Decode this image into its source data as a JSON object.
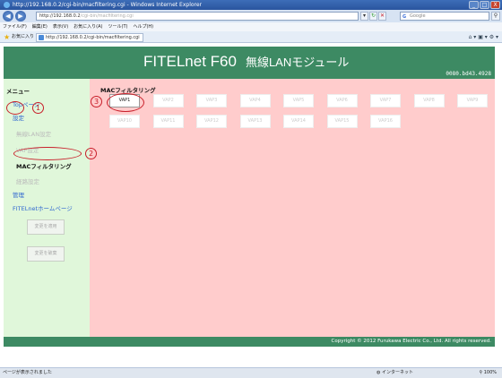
{
  "window": {
    "title": "http://192.168.0.2/cgi-bin/macfiltering.cgi - Windows Internet Explorer",
    "minimize": "_",
    "maximize": "□",
    "close": "X"
  },
  "browser": {
    "back": "◀",
    "forward": "▶",
    "address_host": "http://192.168.0.2",
    "address_path": "/cgi-bin/macfiltering.cgi",
    "search_placeholder": "Google",
    "menu": [
      "ファイル(F)",
      "編集(E)",
      "表示(V)",
      "お気に入り(A)",
      "ツール(T)",
      "ヘルプ(H)"
    ],
    "favorites_label": "お気に入り",
    "tab_title": "http://192.168.0.2/cgi-bin/macfiltering.cgi"
  },
  "banner": {
    "title": "FITELnet F60",
    "subtitle": "無線LANモジュール",
    "mac": "0080.bd43.4928"
  },
  "sidebar": {
    "menu_heading": "メニュー",
    "top_page": "Topページ",
    "settings": "設定",
    "wireless_lan": "無線LAN設定",
    "vap": "VAP設定",
    "mac_filtering": "MACフィルタリング",
    "route": "経路設定",
    "management": "管理",
    "homepage": "FITELnetホームページ",
    "apply_button": "変更を適用",
    "discard_button": "変更を破棄"
  },
  "main": {
    "heading": "MACフィルタリング",
    "vaps": [
      "VAP1",
      "VAP2",
      "VAP3",
      "VAP4",
      "VAP5",
      "VAP6",
      "VAP7",
      "VAP8",
      "VAP9",
      "VAP10",
      "VAP11",
      "VAP12",
      "VAP13",
      "VAP14",
      "VAP15",
      "VAP16"
    ],
    "active_vap": "VAP1"
  },
  "annotations": {
    "n1": "1",
    "n2": "2",
    "n3": "3",
    "color": "#c81f2a"
  },
  "footer": {
    "copyright": "Copyright © 2012 Furukawa Electric Co., Ltd. All rights reserved."
  },
  "statusbar": {
    "text": "ページが表示されました",
    "zone": "インターネット",
    "zoom": "100%"
  },
  "colors": {
    "banner": "#3d8a63",
    "sidebar": "#e0f7da",
    "main": "#ffcccc"
  }
}
